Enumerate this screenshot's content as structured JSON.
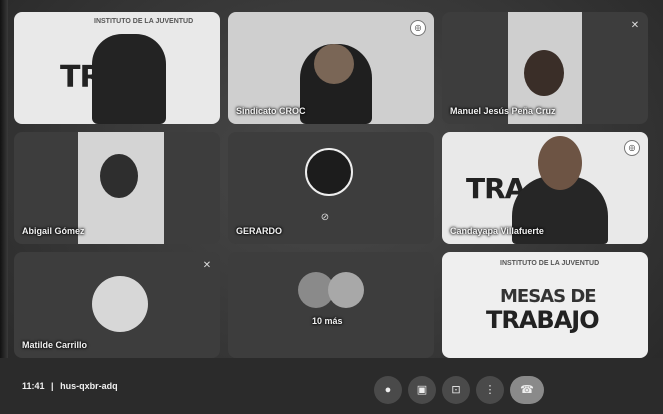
{
  "meeting": {
    "time": "11:41",
    "separator": "|",
    "code": "hus-qxbr-adq"
  },
  "participants": [
    {
      "name": "",
      "kind": "video-poster",
      "poster": "TRA",
      "logo": "INSTITUTO DE LA JUVENTUD"
    },
    {
      "name": "Sindicato CROC",
      "kind": "video"
    },
    {
      "name": "Manuel Jesús Peña Cruz",
      "kind": "video"
    },
    {
      "name": "Abigail Gómez",
      "kind": "video"
    },
    {
      "name": "GERARDO",
      "kind": "camera-off"
    },
    {
      "name": "Candayapa Villafuerte",
      "kind": "video-poster",
      "poster": "TRA"
    },
    {
      "name": "Matilde Carrillo",
      "kind": "avatar"
    },
    {
      "name": "10 más",
      "kind": "others"
    },
    {
      "name": "",
      "kind": "presentation",
      "poster_line1": "MESAS DE",
      "poster_line2": "TRABAJO",
      "logo": "INSTITUTO DE LA JUVENTUD"
    }
  ],
  "controls": [
    {
      "label": "mic",
      "icon": "microphone-icon"
    },
    {
      "label": "camera",
      "icon": "camera-icon"
    },
    {
      "label": "present",
      "icon": "present-icon"
    },
    {
      "label": "more",
      "icon": "more-options-icon"
    },
    {
      "label": "end call",
      "icon": "hangup-icon"
    }
  ],
  "colors": {
    "background": "#3a3a3a",
    "bar": "#2b2b2b",
    "tile": "#4b4b4b",
    "light_tile": "#e9e9e9"
  }
}
